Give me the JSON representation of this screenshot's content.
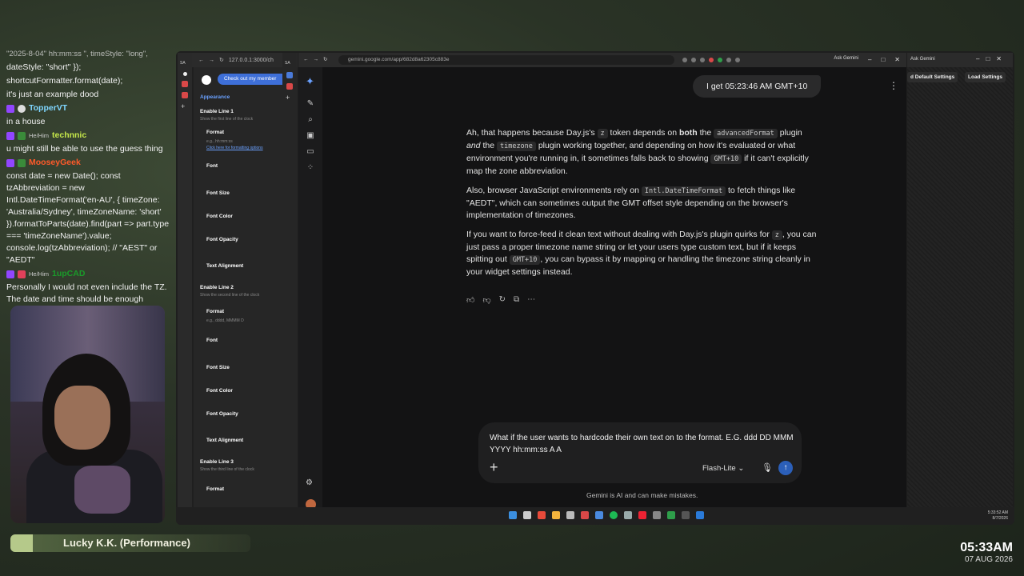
{
  "chat": {
    "cut_line": "\"2025-8-04\" hh:mm:ss \", timeStyle: \"long\",",
    "lines": [
      {
        "type": "text",
        "text": "dateStyle: \"short\" });"
      },
      {
        "type": "text",
        "text": "shortcutFormatter.format(date);"
      },
      {
        "type": "text",
        "text": "it's just an example dood"
      },
      {
        "type": "user",
        "name": "TopperVT",
        "pronouns": "",
        "color": "#7fd6ff"
      },
      {
        "type": "text",
        "text": "in a house"
      },
      {
        "type": "user",
        "name": "technnic",
        "pronouns": "He/Him",
        "color": "#c6e84a"
      },
      {
        "type": "text",
        "text": "u might still be able to use the guess thing"
      },
      {
        "type": "user",
        "name": "MooseyGeek",
        "pronouns": "",
        "color": "#ff5a2a"
      },
      {
        "type": "text",
        "text": "const date = new Date(); const tzAbbreviation = new Intl.DateTimeFormat('en-AU', { timeZone: 'Australia/Sydney', timeZoneName: 'short' }).formatToParts(date).find(part => part.type === 'timeZoneName').value; console.log(tzAbbreviation); // \"AEST\" or \"AEDT\""
      },
      {
        "type": "user",
        "name": "1upCAD",
        "pronouns": "He/Him",
        "color": "#1a9a2a"
      },
      {
        "type": "text",
        "text": "Personally I would not even include the TZ. The date and time should be enough"
      }
    ]
  },
  "now_playing": {
    "title": "Lucky K.K. (Performance)"
  },
  "clock": {
    "time": "05:33AM",
    "date": "07 AUG 2026"
  },
  "left_browser": {
    "url": "127.0.0.1:3000/ch",
    "member_button": "Check out my member",
    "section": "Appearance",
    "line1": {
      "title": "Enable Line 1",
      "sub": "Show the first line of the clock",
      "format_label": "Format",
      "format_placeholder": "e.g., hh:mm:ss",
      "help_link": "Click here for formatting options"
    },
    "line2": {
      "title": "Enable Line 2",
      "sub": "Show the second line of the clock",
      "format_label": "Format",
      "format_placeholder": "e.g., dddd, MMMM D"
    },
    "line3": {
      "title": "Enable Line 3",
      "sub": "Show the third line of the clock",
      "format_label": "Format"
    },
    "fields": [
      "Font",
      "Font Size",
      "Font Color",
      "Font Opacity",
      "Text Alignment"
    ]
  },
  "gemini": {
    "url": "gemini.google.com/app/682d8a62305c883e",
    "ask_button": "Ask Gemini",
    "user_message": "I get 05:23:46 AM GMT+10",
    "answer": {
      "p1": [
        "Ah, that happens because Day.js's ",
        "z",
        " token depends on ",
        "both",
        " the ",
        "advancedFormat",
        " plugin ",
        "and",
        " the ",
        "timezone",
        " plugin working together, and depending on how it's evaluated or what environment you're running in, it sometimes falls back to showing ",
        "GMT+10",
        " if it can't explicitly map the zone abbreviation."
      ],
      "p2": [
        "Also, browser JavaScript environments rely on ",
        "Intl.DateTimeFormat",
        " to fetch things like \"AEDT\", which can sometimes output the GMT offset style depending on the browser's implementation of timezones."
      ],
      "p3": [
        "If you want to force-feed it clean text without dealing with Day.js's plugin quirks for ",
        "z",
        ", you can just pass a proper timezone name string or let your users type custom text, but if it keeps spitting out ",
        "GMT+10",
        ", you can bypass it by mapping or handling the timezone string cleanly in your widget settings instead."
      ]
    },
    "composer_text": "What if the user wants to hardcode their own text on to the format. E.G. ddd DD MMM YYYY hh:mm:ss A A",
    "model": "Flash-Lite",
    "disclaimer": "Gemini is AI and can make mistakes."
  },
  "right_app": {
    "ask_gemini": "Ask Gemini",
    "btn_defaults": "d Default Settings",
    "btn_load": "Load Settings"
  },
  "taskbar": {
    "time": "5:33:52 AM",
    "date": "8/7/2026"
  },
  "icons": {
    "plus": "+",
    "mic": "🎙",
    "send": "↑",
    "more": "⋮",
    "chevron": "⌄",
    "thumbs_up": "👍",
    "thumbs_down": "👎",
    "refresh": "↻",
    "copy": "⧉",
    "ellipsis": "⋯"
  }
}
